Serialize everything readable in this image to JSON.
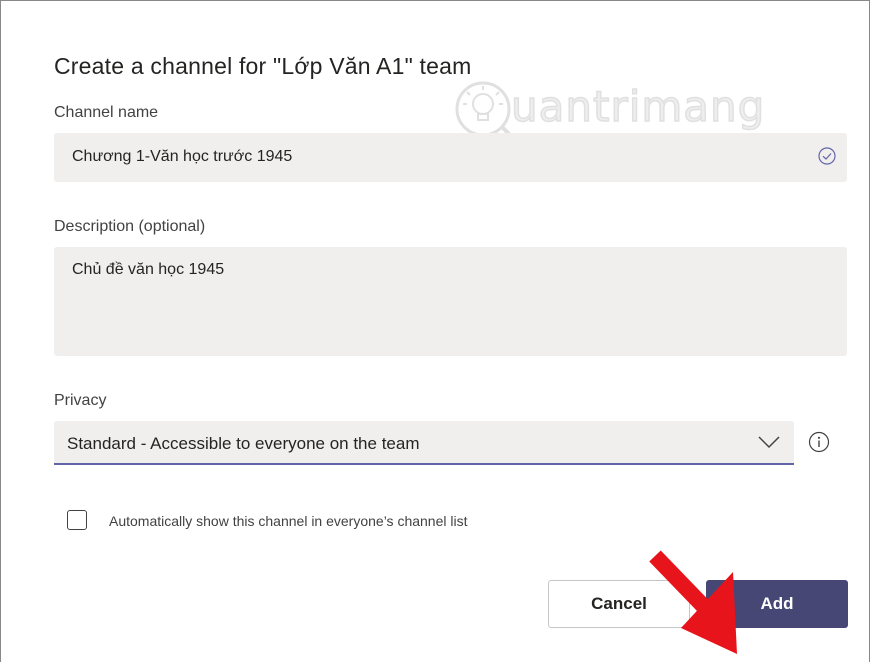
{
  "dialog": {
    "title": "Create a channel for \"Lớp Văn A1\" team",
    "channel_name_label": "Channel name",
    "channel_name_value": "Chương 1-Văn học trước 1945",
    "description_label": "Description (optional)",
    "description_value": "Chủ đề văn học 1945",
    "privacy_label": "Privacy",
    "privacy_selected": "Standard - Accessible to everyone on the team",
    "auto_show_label": "Automatically show this channel in everyone’s channel list",
    "auto_show_checked": false,
    "cancel_label": "Cancel",
    "add_label": "Add"
  },
  "watermark": {
    "text": "uantrimang"
  },
  "icons": {
    "name_valid": "check-circle-icon",
    "privacy_dropdown": "chevron-down-icon",
    "privacy_info": "info-icon",
    "annotation": "red-arrow-icon"
  },
  "colors": {
    "accent": "#6264a7",
    "add_button": "#464775",
    "field_bg": "#f0efee",
    "arrow": "#e8141b"
  }
}
